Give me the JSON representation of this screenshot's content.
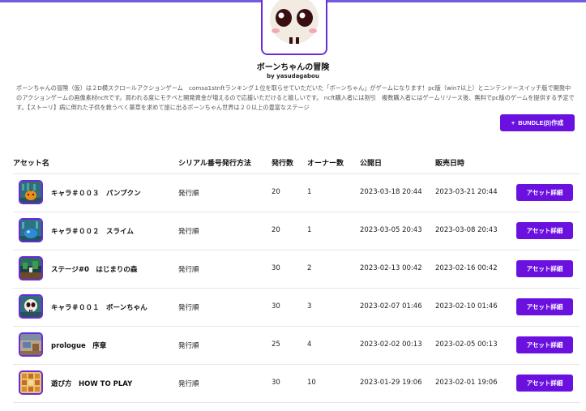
{
  "header": {
    "title": "ボーンちゃんの冒険",
    "author": "by yasudagabou",
    "description": "ボーンちゃんの冒険（仮）は２D横スクロールアクションゲーム　comsa1stnftランキング１位を取らせていただいた「ボーンちゃん」がゲームになります！pc版（win7以上）とニンテンドースイッチ版で開発中のアクションゲームの画像素材ncftです。買われる度にモチベと開発資金が増えるので応援いただけると嬉しいです。 ncft購入者には割引　複数購入者にはゲームリリース後、無料でpc版のゲームを提供する予定です。【ストーリ】病に倒れた子供を救うべく薬草を求めて旅に出るボーンちゃん世界は２０以上の豊富なステージ",
    "bundle_button": "BUNDLE(β)作成",
    "bundle_icon": "+"
  },
  "table": {
    "headers": [
      "アセット名",
      "シリアル番号発行方法",
      "発行数",
      "オーナー数",
      "公開日",
      "販売日時"
    ],
    "detail_button": "アセット詳細",
    "rows": [
      {
        "name": "キャラ＃００３　パンプクン",
        "method": "発行順",
        "issued": "20",
        "owners": "1",
        "published": "2023-03-18 20:44",
        "sale": "2023-03-21 20:44",
        "thumb": "pumpkin"
      },
      {
        "name": "キャラ＃００２　スライム",
        "method": "発行順",
        "issued": "20",
        "owners": "1",
        "published": "2023-03-05 20:43",
        "sale": "2023-03-08 20:43",
        "thumb": "slime"
      },
      {
        "name": "ステージ#0　はじまりの森",
        "method": "発行順",
        "issued": "30",
        "owners": "2",
        "published": "2023-02-13 00:42",
        "sale": "2023-02-16 00:42",
        "thumb": "forest"
      },
      {
        "name": "キャラ＃００１　ボーンちゃん",
        "method": "発行順",
        "issued": "30",
        "owners": "3",
        "published": "2023-02-07 01:46",
        "sale": "2023-02-10 01:46",
        "thumb": "skull"
      },
      {
        "name": "prologue　序章",
        "method": "発行順",
        "issued": "25",
        "owners": "4",
        "published": "2023-02-02 00:13",
        "sale": "2023-02-05 00:13",
        "thumb": "room"
      },
      {
        "name": "遊び方　HOW TO PLAY",
        "method": "発行順",
        "issued": "30",
        "owners": "10",
        "published": "2023-01-29 19:06",
        "sale": "2023-02-01 19:06",
        "thumb": "map"
      }
    ]
  },
  "colors": {
    "accent": "#6a11e0",
    "border": "#6a2bd8"
  }
}
